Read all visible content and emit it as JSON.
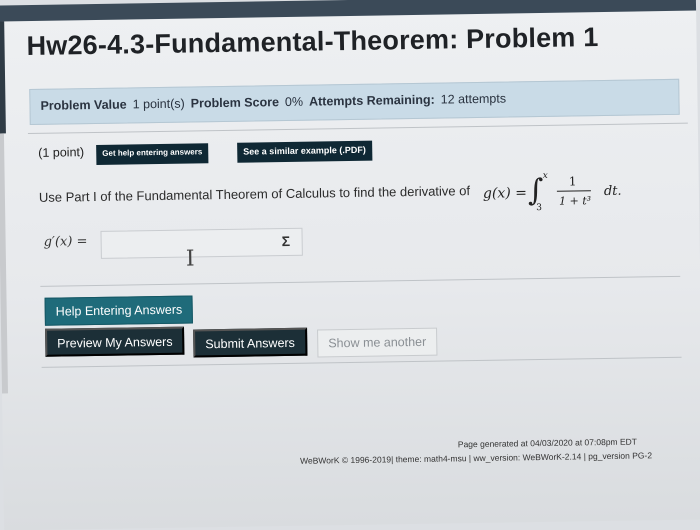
{
  "page": {
    "title": "Hw26-4.3-Fundamental-Theorem: Problem 1"
  },
  "info": {
    "value_label": "Problem Value",
    "value_text": "1 point(s)",
    "score_label": "Problem Score",
    "score_text": "0%",
    "attempts_label": "Attempts Remaining:",
    "attempts_text": "12 attempts"
  },
  "problem": {
    "points": "(1 point)",
    "help_link": "Get help entering answers",
    "example_link": "See a similar example (.PDF)",
    "question": "Use Part I of the Fundamental Theorem of Calculus to find the derivative of",
    "formula": {
      "lhs": "g(x) =",
      "integral": "∫",
      "upper": "x",
      "lower": "3",
      "numerator": "1",
      "denominator": "1 + t³",
      "differential": "dt."
    },
    "answer_label": "g′(x) =",
    "answer_value": "",
    "icons": {
      "cursor": "text-cursor-icon",
      "equation": "sigma-icon"
    }
  },
  "buttons": {
    "help": "Help Entering Answers",
    "preview": "Preview My Answers",
    "submit": "Submit Answers",
    "another": "Show me another"
  },
  "footer": {
    "generated": "Page generated at 04/03/2020 at 07:08pm EDT",
    "copyright": "WeBWorK © 1996-2019| theme: math4-msu | ww_version: WeBWorK-2.14 | pg_version PG-2"
  },
  "colors": {
    "info_bg": "#c9dbe7",
    "dark_button": "#1c2f37",
    "teal_button": "#1f6b7a"
  }
}
